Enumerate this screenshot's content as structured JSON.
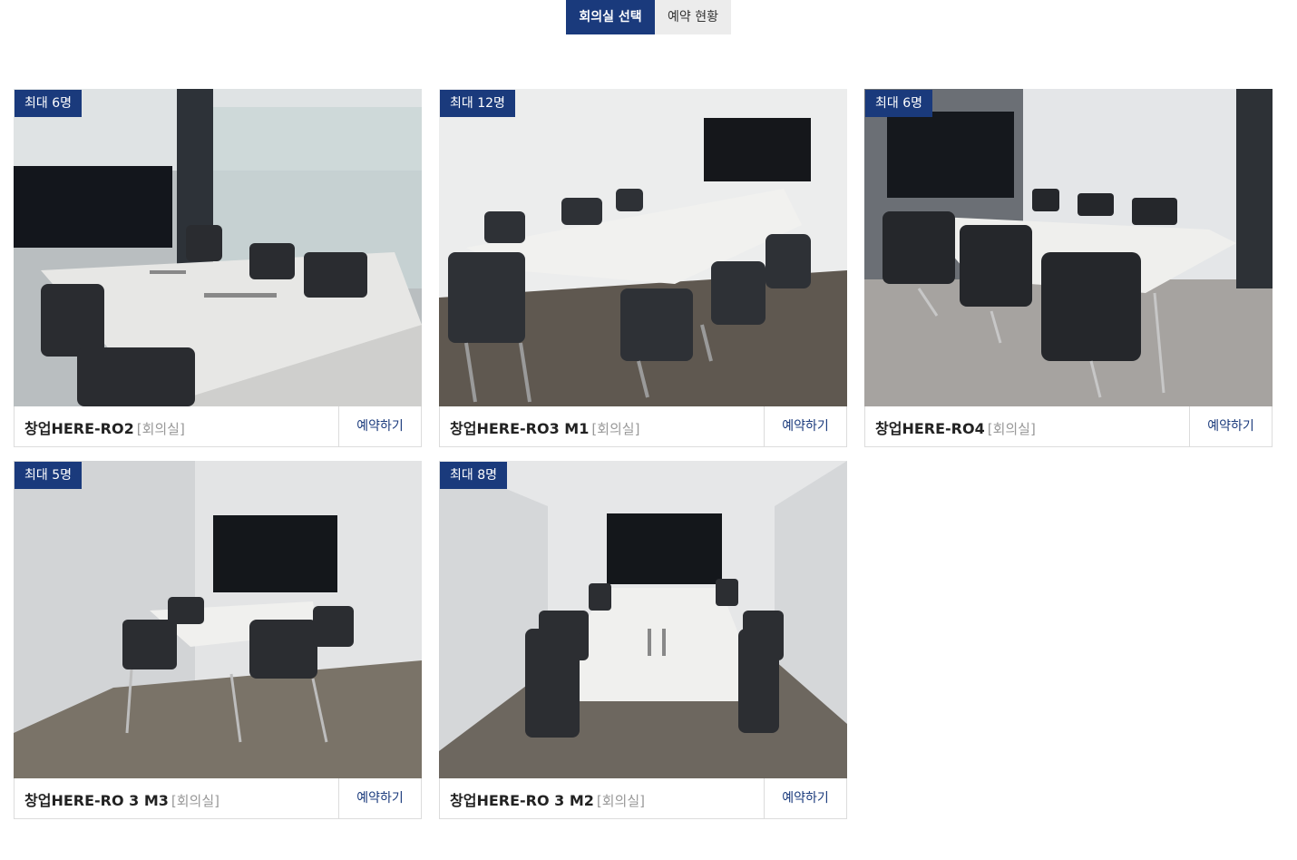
{
  "tabs": [
    {
      "label": "회의실 선택",
      "active": true
    },
    {
      "label": "예약 현황",
      "active": false
    }
  ],
  "accent_color": "#1a3a7c",
  "rooms": [
    {
      "capacity": "최대 6명",
      "name": "창업HERE-RO2",
      "type": "[회의실]",
      "button": "예약하기"
    },
    {
      "capacity": "최대 12명",
      "name": "창업HERE-RO3 M1",
      "type": "[회의실]",
      "button": "예약하기"
    },
    {
      "capacity": "최대 6명",
      "name": "창업HERE-RO4",
      "type": "[회의실]",
      "button": "예약하기"
    },
    {
      "capacity": "최대 5명",
      "name": "창업HERE-RO 3 M3",
      "type": "[회의실]",
      "button": "예약하기"
    },
    {
      "capacity": "최대 8명",
      "name": "창업HERE-RO 3 M2",
      "type": "[회의실]",
      "button": "예약하기"
    }
  ]
}
